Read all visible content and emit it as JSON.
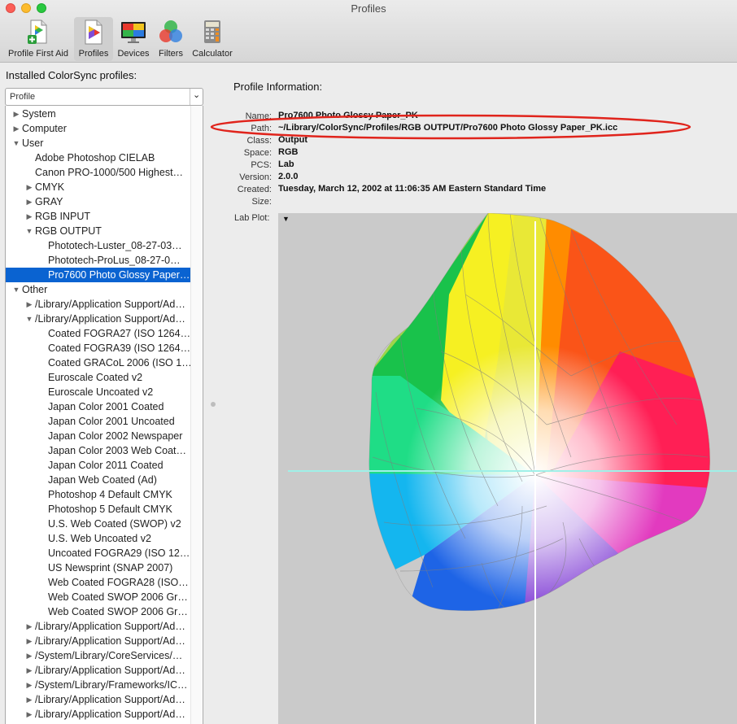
{
  "window": {
    "title": "Profiles"
  },
  "toolbar": {
    "items": [
      {
        "label": "Profile First Aid",
        "icon": "first-aid-icon",
        "selected": false
      },
      {
        "label": "Profiles",
        "icon": "profiles-icon",
        "selected": true
      },
      {
        "label": "Devices",
        "icon": "devices-icon",
        "selected": false
      },
      {
        "label": "Filters",
        "icon": "filters-icon",
        "selected": false
      },
      {
        "label": "Calculator",
        "icon": "calculator-icon",
        "selected": false
      }
    ]
  },
  "sidebar": {
    "heading": "Installed ColorSync profiles:",
    "select_value": "Profile",
    "rows": [
      {
        "label": "System",
        "level": 0,
        "disclosure": "collapsed"
      },
      {
        "label": "Computer",
        "level": 0,
        "disclosure": "collapsed"
      },
      {
        "label": "User",
        "level": 0,
        "disclosure": "expanded"
      },
      {
        "label": "Adobe Photoshop CIELAB",
        "level": 1,
        "disclosure": "none"
      },
      {
        "label": "Canon PRO-1000/500 Highest…",
        "level": 1,
        "disclosure": "none"
      },
      {
        "label": "CMYK",
        "level": 1,
        "disclosure": "collapsed"
      },
      {
        "label": "GRAY",
        "level": 1,
        "disclosure": "collapsed"
      },
      {
        "label": "RGB INPUT",
        "level": 1,
        "disclosure": "collapsed"
      },
      {
        "label": "RGB OUTPUT",
        "level": 1,
        "disclosure": "expanded"
      },
      {
        "label": "Phototech-Luster_08-27-03…",
        "level": 2,
        "disclosure": "none"
      },
      {
        "label": "Phototech-ProLus_08-27-0…",
        "level": 2,
        "disclosure": "none"
      },
      {
        "label": "Pro7600 Photo Glossy Paper…",
        "level": 2,
        "disclosure": "none",
        "selected": true
      },
      {
        "label": "Other",
        "level": 0,
        "disclosure": "expanded"
      },
      {
        "label": "/Library/Application Support/Ad…",
        "level": 1,
        "disclosure": "collapsed"
      },
      {
        "label": "/Library/Application Support/Ad…",
        "level": 1,
        "disclosure": "expanded"
      },
      {
        "label": "Coated FOGRA27 (ISO 1264…",
        "level": 2,
        "disclosure": "none"
      },
      {
        "label": "Coated FOGRA39 (ISO 1264…",
        "level": 2,
        "disclosure": "none"
      },
      {
        "label": "Coated GRACoL 2006 (ISO 1…",
        "level": 2,
        "disclosure": "none"
      },
      {
        "label": "Euroscale Coated v2",
        "level": 2,
        "disclosure": "none"
      },
      {
        "label": "Euroscale Uncoated v2",
        "level": 2,
        "disclosure": "none"
      },
      {
        "label": "Japan Color 2001 Coated",
        "level": 2,
        "disclosure": "none"
      },
      {
        "label": "Japan Color 2001 Uncoated",
        "level": 2,
        "disclosure": "none"
      },
      {
        "label": "Japan Color 2002 Newspaper",
        "level": 2,
        "disclosure": "none"
      },
      {
        "label": "Japan Color 2003 Web Coat…",
        "level": 2,
        "disclosure": "none"
      },
      {
        "label": "Japan Color 2011 Coated",
        "level": 2,
        "disclosure": "none"
      },
      {
        "label": "Japan Web Coated (Ad)",
        "level": 2,
        "disclosure": "none"
      },
      {
        "label": "Photoshop 4 Default CMYK",
        "level": 2,
        "disclosure": "none"
      },
      {
        "label": "Photoshop 5 Default CMYK",
        "level": 2,
        "disclosure": "none"
      },
      {
        "label": "U.S. Web Coated (SWOP) v2",
        "level": 2,
        "disclosure": "none"
      },
      {
        "label": "U.S. Web Uncoated v2",
        "level": 2,
        "disclosure": "none"
      },
      {
        "label": "Uncoated FOGRA29 (ISO 12…",
        "level": 2,
        "disclosure": "none"
      },
      {
        "label": "US Newsprint (SNAP 2007)",
        "level": 2,
        "disclosure": "none"
      },
      {
        "label": "Web Coated FOGRA28 (ISO…",
        "level": 2,
        "disclosure": "none"
      },
      {
        "label": "Web Coated SWOP 2006 Gr…",
        "level": 2,
        "disclosure": "none"
      },
      {
        "label": "Web Coated SWOP 2006 Gr…",
        "level": 2,
        "disclosure": "none"
      },
      {
        "label": "/Library/Application Support/Ad…",
        "level": 1,
        "disclosure": "collapsed"
      },
      {
        "label": "/Library/Application Support/Ad…",
        "level": 1,
        "disclosure": "collapsed"
      },
      {
        "label": "/System/Library/CoreServices/…",
        "level": 1,
        "disclosure": "collapsed"
      },
      {
        "label": "/Library/Application Support/Ad…",
        "level": 1,
        "disclosure": "collapsed"
      },
      {
        "label": "/System/Library/Frameworks/IC…",
        "level": 1,
        "disclosure": "collapsed"
      },
      {
        "label": "/Library/Application Support/Ad…",
        "level": 1,
        "disclosure": "collapsed"
      },
      {
        "label": "/Library/Application Support/Ad…",
        "level": 1,
        "disclosure": "collapsed"
      }
    ]
  },
  "info": {
    "title": "Profile Information:",
    "fields": [
      {
        "label": "Name:",
        "value": "Pro7600 Photo Glossy Paper_PK"
      },
      {
        "label": "Path:",
        "value": "~/Library/ColorSync/Profiles/RGB OUTPUT/Pro7600 Photo Glossy Paper_PK.icc"
      },
      {
        "label": "Class:",
        "value": "Output"
      },
      {
        "label": "Space:",
        "value": "RGB"
      },
      {
        "label": "PCS:",
        "value": "Lab"
      },
      {
        "label": "Version:",
        "value": "2.0.0"
      },
      {
        "label": "Created:",
        "value": "Tuesday, March 12, 2002 at 11:06:35 AM Eastern Standard Time"
      },
      {
        "label": "Size:",
        "value": ""
      }
    ],
    "lab_plot_label": "Lab Plot:",
    "highlight_color": "#e0241c"
  }
}
